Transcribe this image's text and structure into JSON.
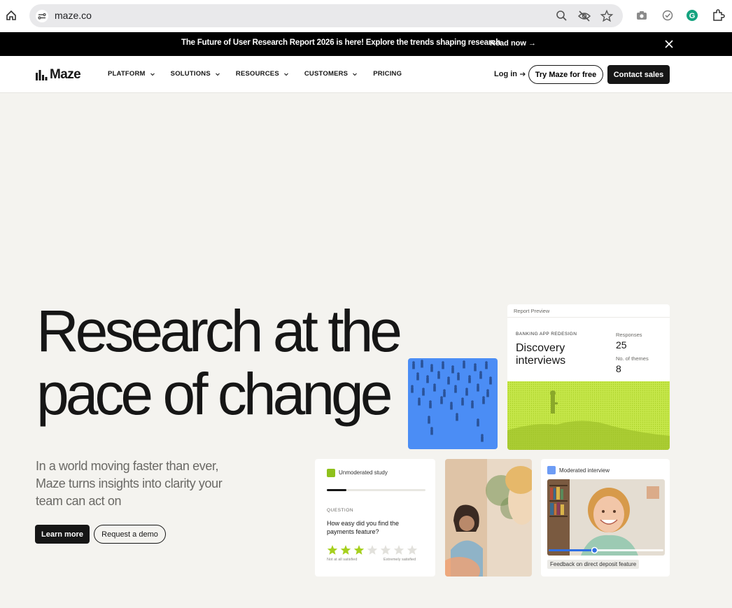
{
  "browser": {
    "url": "maze.co"
  },
  "announcement": {
    "message": "The Future of User Research Report 2026 is here! Explore the trends shaping research",
    "cta": "Read now"
  },
  "nav": {
    "brand": "Maze",
    "items": [
      {
        "label": "PLATFORM",
        "has_menu": true
      },
      {
        "label": "SOLUTIONS",
        "has_menu": true
      },
      {
        "label": "RESOURCES",
        "has_menu": true
      },
      {
        "label": "CUSTOMERS",
        "has_menu": true
      },
      {
        "label": "PRICING",
        "has_menu": false
      }
    ],
    "login": "Log in",
    "try_free": "Try Maze for free",
    "contact_sales": "Contact sales"
  },
  "hero": {
    "headline_line1": "Research at the",
    "headline_line2": "pace of change",
    "subcopy": "In a world moving faster than ever, Maze turns insights into clarity your team can act on",
    "learn_more": "Learn more",
    "request_demo": "Request a demo"
  },
  "report_card": {
    "header": "Report Preview",
    "kicker": "BANKING APP REDESIGN",
    "title": "Discovery interviews",
    "responses_label": "Responses",
    "responses_value": "25",
    "themes_label": "No. of themes",
    "themes_value": "8"
  },
  "study_card": {
    "tag": "Unmoderated study",
    "progress": 0.2,
    "question_label": "QUESTION",
    "question": "How easy did you find the payments feature?",
    "rating": 3,
    "rating_max": 7,
    "low_label": "Not at all satisfied",
    "high_label": "Extremely satisfied"
  },
  "moderated_card": {
    "tag": "Moderated interview",
    "video_progress": 0.4,
    "caption": "Feedback on direct deposit feature"
  },
  "colors": {
    "accent_lime": "#c3e53c",
    "accent_blue": "#4b8df5",
    "star_on": "#a6d01e",
    "star_off": "#e2e1dc",
    "ink": "#161616"
  }
}
